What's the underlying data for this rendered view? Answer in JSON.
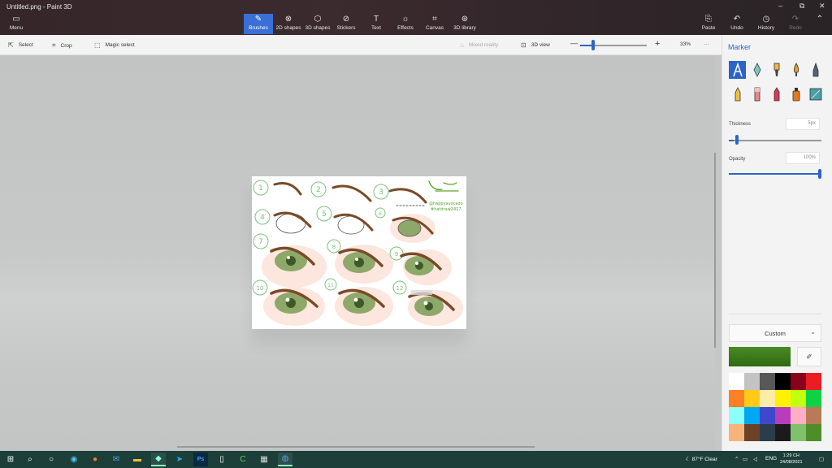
{
  "window": {
    "title": "Untitled.png - Paint 3D",
    "minimize": "–",
    "restore": "⧉",
    "close": "✕"
  },
  "menu": {
    "label": "Menu"
  },
  "tools": [
    {
      "label": "Brushes"
    },
    {
      "label": "2D shapes"
    },
    {
      "label": "3D shapes"
    },
    {
      "label": "Stickers"
    },
    {
      "label": "Text"
    },
    {
      "label": "Effects"
    },
    {
      "label": "Canvas"
    },
    {
      "label": "3D library"
    }
  ],
  "actions": {
    "paste": "Paste",
    "undo": "Undo",
    "history": "History",
    "redo": "Redo"
  },
  "subbar": {
    "select": "Select",
    "crop": "Crop",
    "magic_select": "Magic select",
    "mixed_reality": "Mixed reality",
    "view3d": "3D view",
    "zoom_minus": "—",
    "zoom_plus": "+",
    "zoom_value": "33%",
    "more": "···"
  },
  "zoom_level": 0.2,
  "panel": {
    "title": "Marker",
    "thickness_label": "Thickness",
    "thickness_value": "5px",
    "thickness_level": 0.05,
    "opacity_label": "Opacity",
    "opacity_value": "100%",
    "opacity_level": 1.0,
    "custom_label": "Custom",
    "current_color": "#4a8a24"
  },
  "palette": [
    "#ffffff",
    "#c3c3c3",
    "#585858",
    "#000000",
    "#88001b",
    "#ec1c24",
    "#ff7f27",
    "#ffca18",
    "#fdeca6",
    "#fff200",
    "#c4ff0e",
    "#0ed145",
    "#8cfffb",
    "#00a8f3",
    "#3f48cc",
    "#b83dba",
    "#ffaec8",
    "#b97a56",
    "#f7b37a",
    "#6b4226",
    "#2a3d4a",
    "#1b1b1b",
    "#7fc26b",
    "#4e8d2a"
  ],
  "artwork": {
    "numbers": [
      "1",
      "2",
      "3",
      "4",
      "5",
      "6",
      "7",
      "8",
      "9",
      "10",
      "11",
      "12"
    ],
    "signature_line1": "@happyavocado",
    "signature_line2": "#hatdraw2417"
  },
  "taskbar": {
    "weather": "87°F  Clear",
    "language": "ENG",
    "time": "1:29 CH",
    "date": "24/08/2021",
    "ps_label": "Ps"
  }
}
